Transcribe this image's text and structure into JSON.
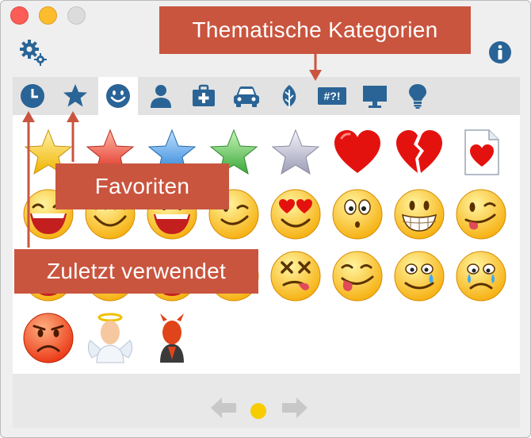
{
  "window": {
    "controls": [
      "close",
      "minimize",
      "maximize"
    ]
  },
  "toolbar": {
    "settings_icon": "gear-icon",
    "info_icon": "info-icon"
  },
  "tabs": [
    {
      "name": "recent",
      "icon": "clock-icon",
      "active": false
    },
    {
      "name": "favorites",
      "icon": "star-icon",
      "active": false
    },
    {
      "name": "smileys",
      "icon": "smiley-icon",
      "active": true
    },
    {
      "name": "people",
      "icon": "person-icon",
      "active": false
    },
    {
      "name": "medical",
      "icon": "first-aid-kit-icon",
      "active": false
    },
    {
      "name": "vehicles",
      "icon": "car-icon",
      "active": false
    },
    {
      "name": "nature",
      "icon": "leaf-icon",
      "active": false
    },
    {
      "name": "symbols",
      "icon": "symbols-icon",
      "label": "#?!",
      "active": false
    },
    {
      "name": "objects",
      "icon": "monitor-icon",
      "active": false
    },
    {
      "name": "ideas",
      "icon": "lightbulb-icon",
      "active": false
    }
  ],
  "emojis": [
    "star-yellow",
    "star-red",
    "star-blue",
    "star-green",
    "star-silver",
    "heart-red",
    "heart-broken",
    "heart-document",
    "laughing-face",
    "smiling-face",
    "grinning-face",
    "winking-face",
    "heart-eyes-face",
    "surprised-face",
    "toothy-grin-face",
    "tongue-out-face",
    "laughing-face-2",
    "smiling-face-2",
    "grinning-face-2",
    "smirking-face",
    "dizzy-face",
    "tongue-wink-face",
    "crying-laughing-face",
    "crying-face",
    "angry-face",
    "angel",
    "devil"
  ],
  "pagination": {
    "prev_icon": "arrow-left-icon",
    "next_icon": "arrow-right-icon",
    "pages": 1,
    "current": 1
  },
  "annotations": {
    "categories": "Thematische Kategorien",
    "favorites": "Favoriten",
    "recent": "Zuletzt verwendet"
  },
  "colors": {
    "tab_icon": "#2a6496",
    "callout": "#c9553f",
    "page_dot": "#f7cc00"
  }
}
